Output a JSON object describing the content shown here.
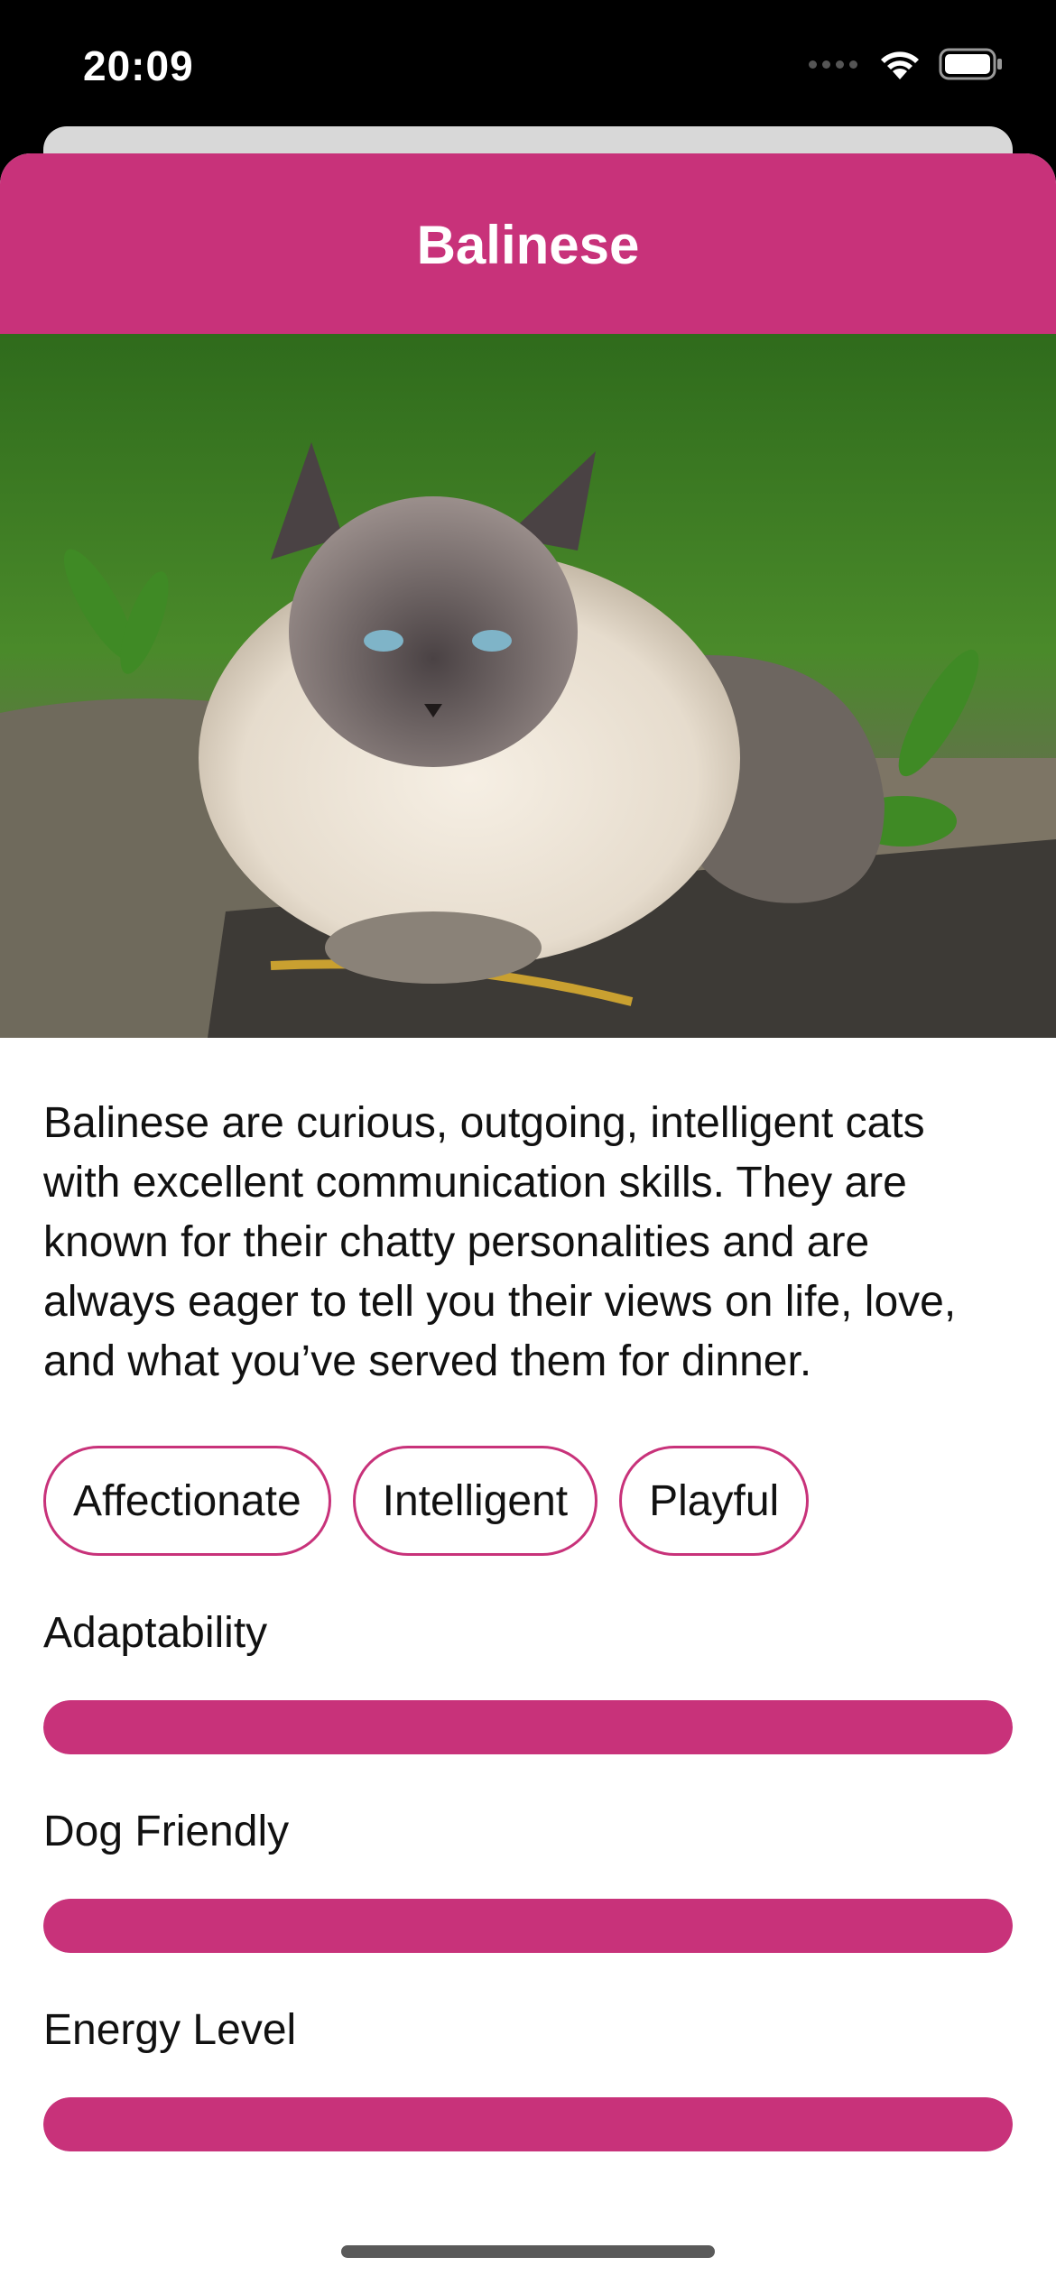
{
  "status_bar": {
    "time": "20:09"
  },
  "theme": {
    "accent": "#C8327A"
  },
  "nav": {
    "title": "Balinese"
  },
  "hero": {
    "image_alt": "Balinese cat photo"
  },
  "description": "Balinese are curious, outgoing, intelligent cats with excellent communication skills. They are known for their chatty personalities and are always eager to tell you their views on life, love, and what you’ve served them for dinner.",
  "temperament": [
    "Affectionate",
    "Intelligent",
    "Playful"
  ],
  "stats": [
    {
      "label": "Adaptability",
      "level": 1.0
    },
    {
      "label": "Dog Friendly",
      "level": 1.0
    },
    {
      "label": "Energy Level",
      "level": 1.0
    }
  ]
}
